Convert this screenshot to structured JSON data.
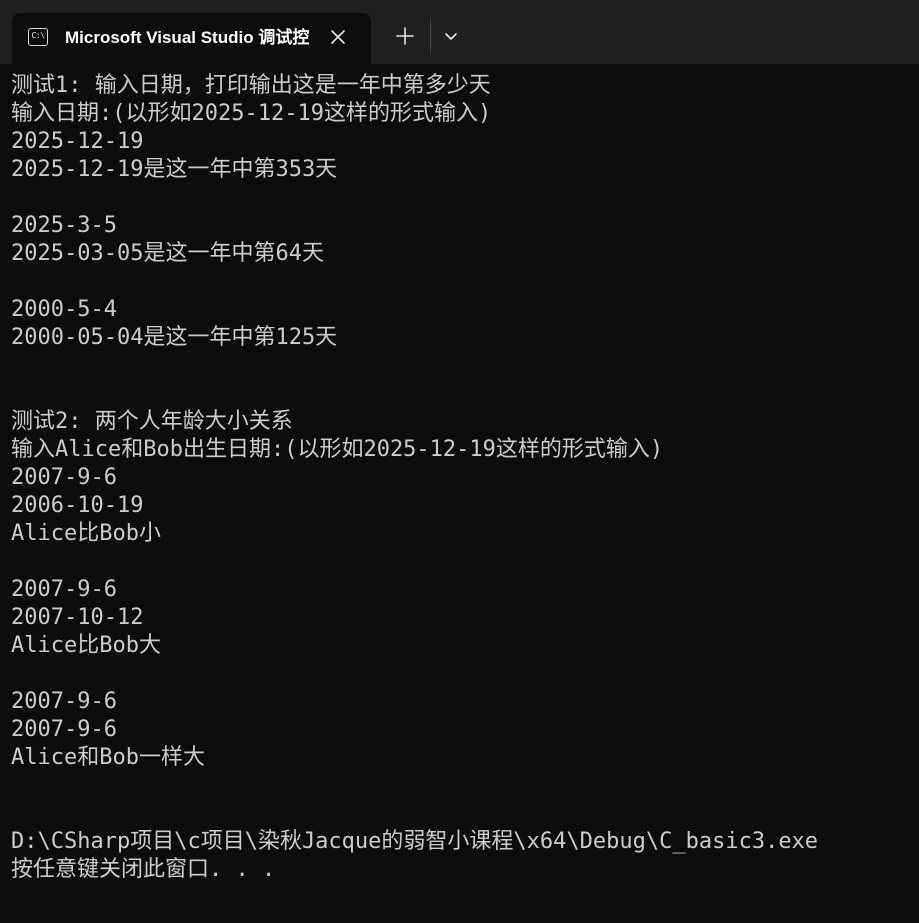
{
  "window": {
    "tab_title": "Microsoft Visual Studio 调试控",
    "tab_icon_text": "C:\\",
    "colors": {
      "titlebar": "#202020",
      "console_bg": "#0c0c0c",
      "console_text": "#cccccc"
    }
  },
  "console": {
    "lines": [
      "测试1: 输入日期，打印输出这是一年中第多少天",
      "输入日期:(以形如2025-12-19这样的形式输入)",
      "2025-12-19",
      "2025-12-19是这一年中第353天",
      "",
      "2025-3-5",
      "2025-03-05是这一年中第64天",
      "",
      "2000-5-4",
      "2000-05-04是这一年中第125天",
      "",
      "",
      "测试2: 两个人年龄大小关系",
      "输入Alice和Bob出生日期:(以形如2025-12-19这样的形式输入)",
      "2007-9-6",
      "2006-10-19",
      "Alice比Bob小",
      "",
      "2007-9-6",
      "2007-10-12",
      "Alice比Bob大",
      "",
      "2007-9-6",
      "2007-9-6",
      "Alice和Bob一样大",
      "",
      "",
      "D:\\CSharp项目\\c项目\\染秋Jacque的弱智小课程\\x64\\Debug\\C_basic3.exe",
      "按任意键关闭此窗口. . ."
    ]
  }
}
